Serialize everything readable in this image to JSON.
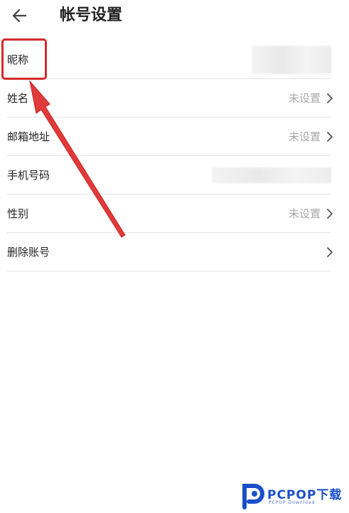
{
  "header": {
    "title": "帐号设置"
  },
  "rows": [
    {
      "label": "昵称",
      "value": ""
    },
    {
      "label": "姓名",
      "value": "未设置"
    },
    {
      "label": "邮箱地址",
      "value": "未设置"
    },
    {
      "label": "手机号码",
      "value": ""
    },
    {
      "label": "性别",
      "value": "未设置"
    },
    {
      "label": "删除账号",
      "value": ""
    }
  ],
  "watermark": {
    "brand": "PCPOP下载",
    "sub": "PCPOP Download"
  },
  "colors": {
    "highlight": "#d32b2b",
    "watermark": "#1a4fc9",
    "muted": "#a8a8a8"
  }
}
